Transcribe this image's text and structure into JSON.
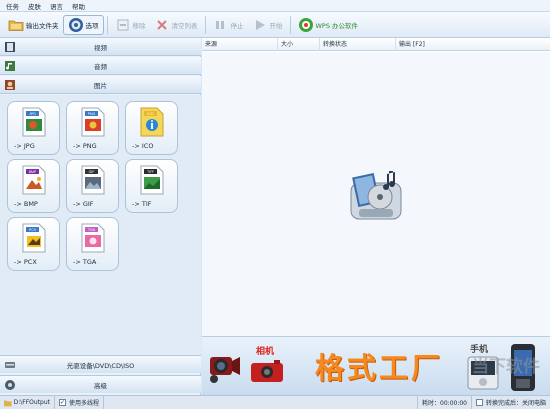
{
  "menu": [
    "任务",
    "皮肤",
    "语言",
    "帮助"
  ],
  "toolbar": [
    {
      "label": "输出文件夹",
      "icon": "folder-icon",
      "enabled": true
    },
    {
      "label": "选项",
      "icon": "options-icon",
      "enabled": true
    },
    {
      "label": "移除",
      "icon": "remove-icon",
      "enabled": false
    },
    {
      "label": "清空列表",
      "icon": "clear-list-icon",
      "enabled": false
    },
    {
      "label": "停止",
      "icon": "stop-icon",
      "enabled": false
    },
    {
      "label": "开始",
      "icon": "start-icon",
      "enabled": false
    },
    {
      "label": "WPS 办公软件",
      "icon": "wps-icon",
      "enabled": true
    }
  ],
  "categories": [
    {
      "label": "视频",
      "icon": "video-icon"
    },
    {
      "label": "音频",
      "icon": "audio-icon"
    },
    {
      "label": "图片",
      "icon": "picture-icon"
    }
  ],
  "formats": [
    {
      "label": "-> JPG",
      "badge": "JPG",
      "color": "#3a78c8"
    },
    {
      "label": "-> PNG",
      "badge": "PNG",
      "color": "#3a78c8"
    },
    {
      "label": "-> ICO",
      "badge": "ICO",
      "color": "#2a86d8"
    },
    {
      "label": "-> BMP",
      "badge": "BMP",
      "color": "#7a2fa8"
    },
    {
      "label": "-> GIF",
      "badge": "GIF",
      "color": "#333333"
    },
    {
      "label": "-> TIF",
      "badge": "TIFF",
      "color": "#2a2a2a"
    },
    {
      "label": "-> PCX",
      "badge": "PCX",
      "color": "#3a78c8"
    },
    {
      "label": "-> TGA",
      "badge": "TGA",
      "color": "#c060c0"
    }
  ],
  "bottom_categories": [
    {
      "label": "光驱设备\\DVD\\CD\\ISO",
      "icon": "optical-drive-icon"
    },
    {
      "label": "高级",
      "icon": "advanced-icon"
    }
  ],
  "table": {
    "headers": [
      "来源",
      "大小",
      "转换状态",
      "输出 [F2]"
    ]
  },
  "banner": {
    "brand": "格式工厂",
    "tag_camera": "相机",
    "tag_phone": "手机"
  },
  "status": {
    "output_path": "D:\\FFOutput",
    "multithread_label": "使用多线程",
    "multithread_checked": true,
    "elapsed": "耗时：00:00:00",
    "after_convert_label": "转换完成后：关闭电脑",
    "after_convert_checked": false
  },
  "watermark": "当下软件"
}
